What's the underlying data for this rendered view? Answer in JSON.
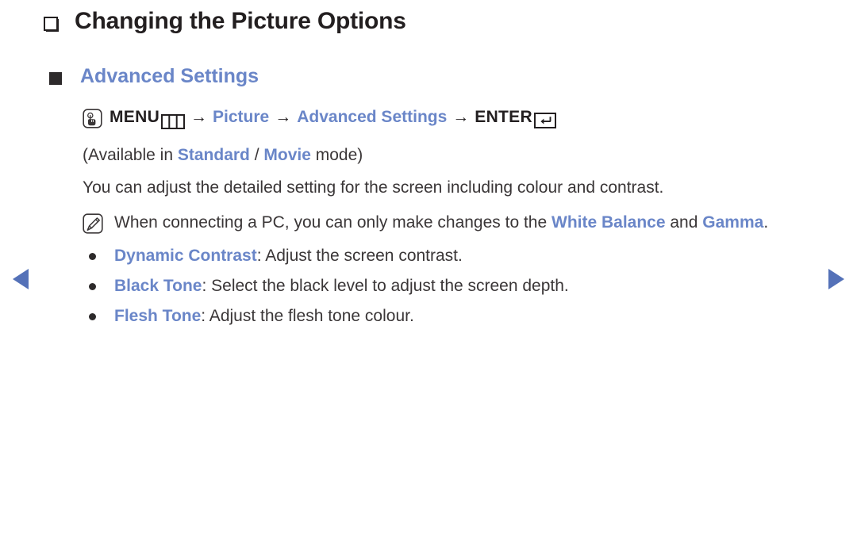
{
  "colors": {
    "accent_blue": "#6a86c8",
    "text_dark": "#231f20",
    "body_text": "#3a3637",
    "bullet_dark": "#2d2a2b",
    "background": "#ffffff"
  },
  "page": {
    "title": "Changing the Picture Options",
    "title_bullet_icon": "hollow-square-bullet-icon",
    "subheading": "Advanced Settings",
    "subheading_bullet_icon": "filled-square-bullet-icon"
  },
  "menu_path": {
    "press_icon": "finger-press-button-icon",
    "menu_label": "MENU",
    "menu_box_icon": "menu-three-column-icon",
    "arrow1": "→",
    "item1": "Picture",
    "arrow2": "→",
    "item2": "Advanced Settings",
    "arrow3": "→",
    "enter_label": "ENTER",
    "enter_box_icon": "enter-return-arrow-icon"
  },
  "availability": {
    "prefix": "(Available in ",
    "mode1": "Standard",
    "separator": " / ",
    "mode2": "Movie",
    "suffix": " mode)"
  },
  "description": "You can adjust the detailed setting for the screen including colour and contrast.",
  "note": {
    "icon": "note-pencil-icon",
    "text_before": "When connecting a PC, you can only make changes to the ",
    "highlight1": "White Balance",
    "text_middle": " and ",
    "highlight2": "Gamma",
    "text_after": "."
  },
  "options": [
    {
      "bullet_icon": "round-bullet-icon",
      "term": "Dynamic Contrast",
      "description": ": Adjust the screen contrast."
    },
    {
      "bullet_icon": "round-bullet-icon",
      "term": "Black Tone",
      "description": ": Select the black level to adjust the screen depth."
    },
    {
      "bullet_icon": "round-bullet-icon",
      "term": "Flesh Tone",
      "description": ": Adjust the flesh tone colour."
    }
  ],
  "navigation": {
    "prev_icon": "previous-page-triangle-icon",
    "next_icon": "next-page-triangle-icon"
  }
}
